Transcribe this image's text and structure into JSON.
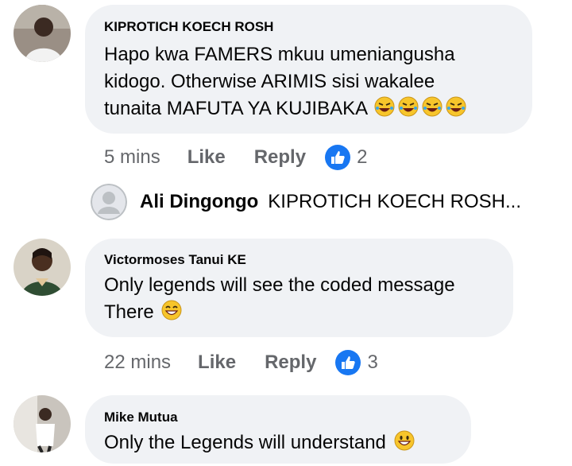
{
  "comments": [
    {
      "author": "KIPROTICH KOECH  ROSH",
      "lines": [
        "Hapo kwa FAMERS mkuu umeniangusha",
        "kidogo.  Otherwise ARIMIS sisi wakalee",
        "tunaita MAFUTA YA KUJIBAKA"
      ],
      "trailing_emoji": [
        "rolling-on-floor-laughing",
        "rolling-on-floor-laughing",
        "rolling-on-floor-laughing",
        "rolling-on-floor-laughing"
      ],
      "time": "5 mins",
      "like_label": "Like",
      "reply_label": "Reply",
      "reaction_count": "2"
    },
    {
      "author": "Victormoses Tanui KE",
      "lines": [
        "Only legends will see the coded message",
        "There"
      ],
      "trailing_emoji": [
        "grinning-face-with-smiling-eyes"
      ],
      "time": "22 mins",
      "like_label": "Like",
      "reply_label": "Reply",
      "reaction_count": "3"
    },
    {
      "author": "Mike Mutua",
      "lines": [
        "Only the Legends will understand"
      ],
      "trailing_emoji": [
        "grinning-face"
      ]
    }
  ],
  "reply": {
    "author": "Ali Dingongo",
    "preview": "KIPROTICH KOECH  ROSH..."
  },
  "colors": {
    "bubble": "#f0f2f5",
    "text": "#050505",
    "secondary": "#65676b",
    "like_blue": "#1877f2"
  }
}
